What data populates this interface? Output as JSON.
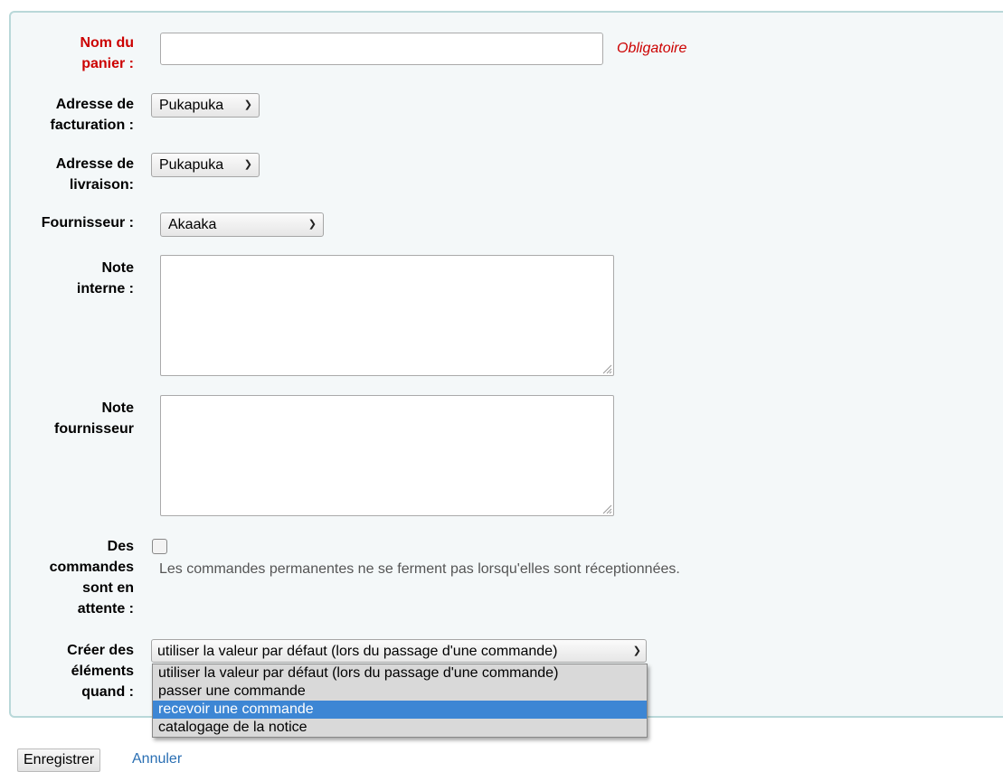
{
  "form": {
    "basket_name": {
      "label_1": "Nom du",
      "label_2": "panier :",
      "value": "",
      "required_text": "Obligatoire"
    },
    "billing_address": {
      "label_1": "Adresse de",
      "label_2": "facturation :",
      "selected": "Pukapuka"
    },
    "delivery_address": {
      "label_1": "Adresse de",
      "label_2": "livraison:",
      "selected": "Pukapuka"
    },
    "vendor": {
      "label": "Fournisseur :",
      "selected": "Akaaka"
    },
    "internal_note": {
      "label_1": "Note",
      "label_2": "interne :",
      "value": ""
    },
    "vendor_note": {
      "label_1": "Note",
      "label_2": "fournisseur",
      "value": ""
    },
    "standing_orders": {
      "label_1": "Des",
      "label_2": "commandes",
      "label_3": "sont en",
      "label_4": "attente :",
      "checked": false,
      "hint": "Les commandes permanentes ne se ferment pas lorsqu'elles sont réceptionnées."
    },
    "create_items": {
      "label_1": "Créer des",
      "label_2": "éléments",
      "label_3": "quand :",
      "selected": "utiliser la valeur par défaut (lors du passage d'une commande)",
      "options": [
        "utiliser la valeur par défaut (lors du passage d'une commande)",
        "passer une commande",
        "recevoir une commande",
        "catalogage de la notice"
      ],
      "highlighted_index": 2
    }
  },
  "actions": {
    "save_label": "Enregistrer",
    "cancel_label": "Annuler"
  },
  "colors": {
    "required": "#cc0000",
    "link": "#2a6fb3",
    "highlight": "#3d86d4",
    "fieldset_border": "#b9d8d9"
  }
}
